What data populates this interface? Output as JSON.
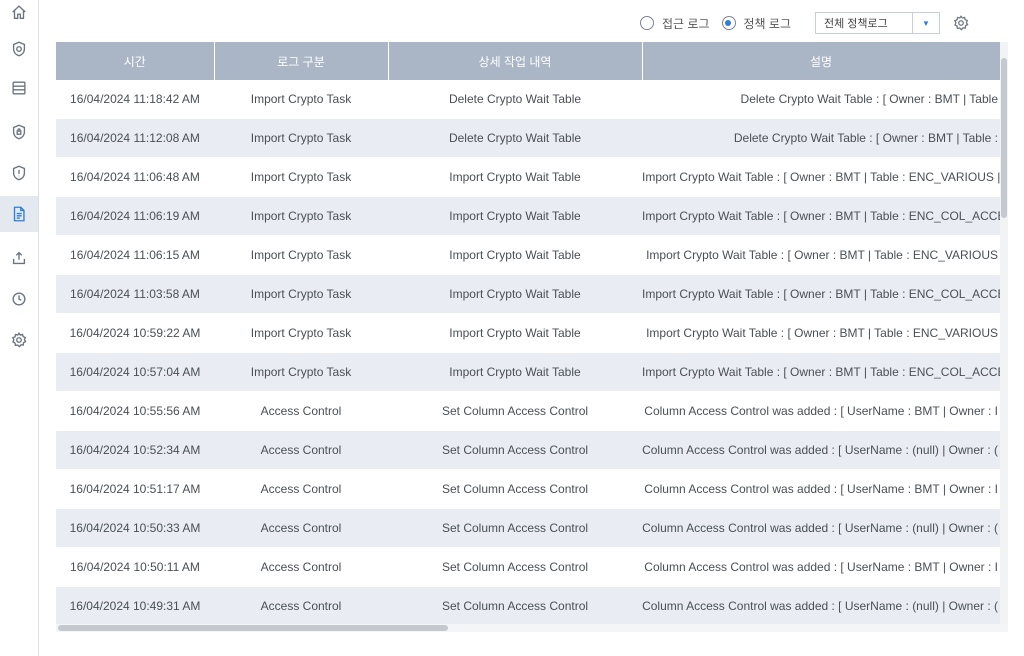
{
  "sidebar": {
    "items": [
      {
        "icon": "home-icon"
      },
      {
        "icon": "shield-icon"
      },
      {
        "icon": "table-icon"
      },
      {
        "icon": "shield-lock-icon"
      },
      {
        "icon": "shield-alert-icon"
      },
      {
        "icon": "document-icon",
        "active": true
      },
      {
        "icon": "upload-icon"
      },
      {
        "icon": "clock-icon"
      },
      {
        "icon": "gear-icon"
      }
    ]
  },
  "toolbar": {
    "radio_access_log": "접근 로그",
    "radio_policy_log": "정책 로그",
    "selected_radio": "policy",
    "filter_value": "전체 정책로그",
    "settings_icon": "gear-icon"
  },
  "table": {
    "headers": [
      "시간",
      "로그 구분",
      "상세 작업 내역",
      "설명"
    ],
    "rows": [
      {
        "time": "16/04/2024 11:18:42 AM",
        "type": "Import Crypto Task",
        "detail": "Delete Crypto Wait Table",
        "desc": "Delete Crypto Wait Table : [ Owner : BMT | Table"
      },
      {
        "time": "16/04/2024 11:12:08 AM",
        "type": "Import Crypto Task",
        "detail": "Delete Crypto Wait Table",
        "desc": "Delete Crypto Wait Table : [ Owner : BMT | Table :"
      },
      {
        "time": "16/04/2024 11:06:48 AM",
        "type": "Import Crypto Task",
        "detail": "Import Crypto Wait Table",
        "desc": "Import Crypto Wait Table : [ Owner : BMT | Table : ENC_VARIOUS |"
      },
      {
        "time": "16/04/2024 11:06:19 AM",
        "type": "Import Crypto Task",
        "detail": "Import Crypto Wait Table",
        "desc": "Import Crypto Wait Table : [ Owner : BMT | Table : ENC_COL_ACCE"
      },
      {
        "time": "16/04/2024 11:06:15 AM",
        "type": "Import Crypto Task",
        "detail": "Import Crypto Wait Table",
        "desc": "Import Crypto Wait Table : [ Owner : BMT | Table : ENC_VARIOUS"
      },
      {
        "time": "16/04/2024 11:03:58 AM",
        "type": "Import Crypto Task",
        "detail": "Import Crypto Wait Table",
        "desc": "Import Crypto Wait Table : [ Owner : BMT | Table : ENC_COL_ACCE"
      },
      {
        "time": "16/04/2024 10:59:22 AM",
        "type": "Import Crypto Task",
        "detail": "Import Crypto Wait Table",
        "desc": "Import Crypto Wait Table : [ Owner : BMT | Table : ENC_VARIOUS"
      },
      {
        "time": "16/04/2024 10:57:04 AM",
        "type": "Import Crypto Task",
        "detail": "Import Crypto Wait Table",
        "desc": "Import Crypto Wait Table : [ Owner : BMT | Table : ENC_COL_ACCE"
      },
      {
        "time": "16/04/2024 10:55:56 AM",
        "type": "Access Control",
        "detail": "Set Column Access Control",
        "desc": "Column Access Control was added : [ UserName : BMT | Owner : I"
      },
      {
        "time": "16/04/2024 10:52:34 AM",
        "type": "Access Control",
        "detail": "Set Column Access Control",
        "desc": "Column Access Control was added : [ UserName : (null) | Owner : ("
      },
      {
        "time": "16/04/2024 10:51:17 AM",
        "type": "Access Control",
        "detail": "Set Column Access Control",
        "desc": "Column Access Control was added : [ UserName : BMT | Owner : I"
      },
      {
        "time": "16/04/2024 10:50:33 AM",
        "type": "Access Control",
        "detail": "Set Column Access Control",
        "desc": "Column Access Control was added : [ UserName : (null) | Owner : ("
      },
      {
        "time": "16/04/2024 10:50:11 AM",
        "type": "Access Control",
        "detail": "Set Column Access Control",
        "desc": "Column Access Control was added : [ UserName : BMT | Owner : I"
      },
      {
        "time": "16/04/2024 10:49:31 AM",
        "type": "Access Control",
        "detail": "Set Column Access Control",
        "desc": "Column Access Control was added : [ UserName : (null) | Owner : ("
      }
    ]
  },
  "colors": {
    "header_bg": "#aab5c5",
    "row_alt_bg": "#e9edf3",
    "accent": "#2f7fd8"
  }
}
